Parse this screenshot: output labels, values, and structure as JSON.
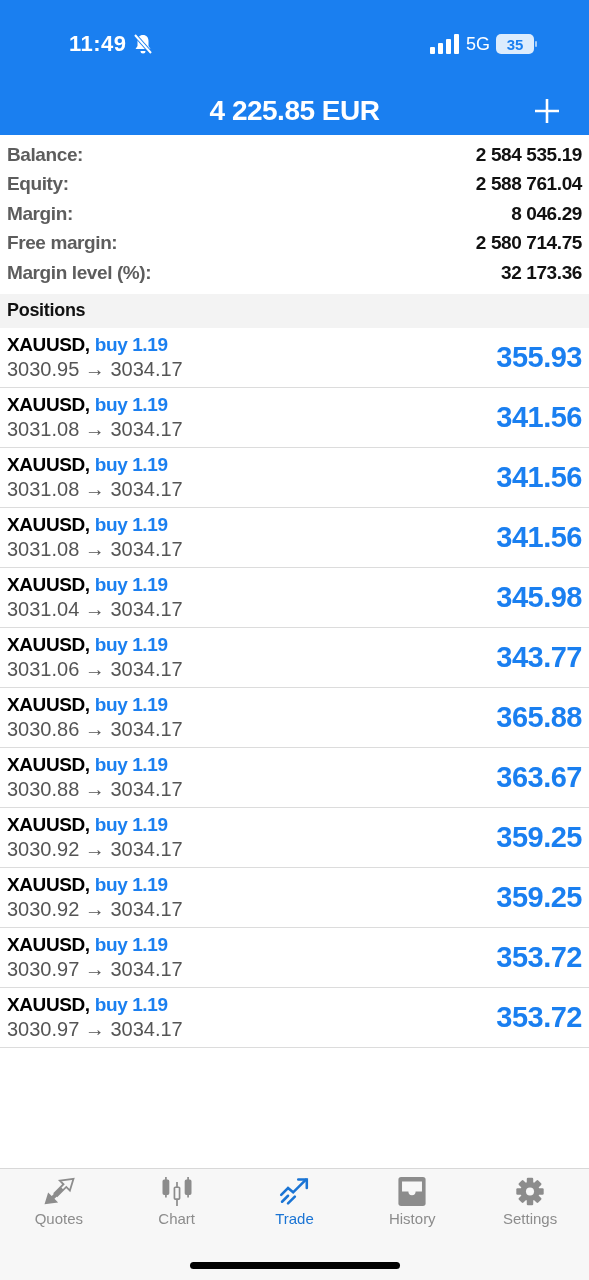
{
  "status_bar": {
    "time": "11:49",
    "network": "5G",
    "battery": "35"
  },
  "header": {
    "title": "4 225.85 EUR"
  },
  "summary": [
    {
      "label": "Balance:",
      "value": "2 584 535.19"
    },
    {
      "label": "Equity:",
      "value": "2 588 761.04"
    },
    {
      "label": "Margin:",
      "value": "8 046.29"
    },
    {
      "label": "Free margin:",
      "value": "2 580 714.75"
    },
    {
      "label": "Margin level (%):",
      "value": "32 173.36"
    }
  ],
  "positions": {
    "title": "Positions",
    "rows": [
      {
        "symbol": "XAUUSD,",
        "order": "buy 1.19",
        "prices": "3030.95 → 3034.17",
        "profit": "355.93"
      },
      {
        "symbol": "XAUUSD,",
        "order": "buy 1.19",
        "prices": "3031.08 → 3034.17",
        "profit": "341.56"
      },
      {
        "symbol": "XAUUSD,",
        "order": "buy 1.19",
        "prices": "3031.08 → 3034.17",
        "profit": "341.56"
      },
      {
        "symbol": "XAUUSD,",
        "order": "buy 1.19",
        "prices": "3031.08 → 3034.17",
        "profit": "341.56"
      },
      {
        "symbol": "XAUUSD,",
        "order": "buy 1.19",
        "prices": "3031.04 → 3034.17",
        "profit": "345.98"
      },
      {
        "symbol": "XAUUSD,",
        "order": "buy 1.19",
        "prices": "3031.06 → 3034.17",
        "profit": "343.77"
      },
      {
        "symbol": "XAUUSD,",
        "order": "buy 1.19",
        "prices": "3030.86 → 3034.17",
        "profit": "365.88"
      },
      {
        "symbol": "XAUUSD,",
        "order": "buy 1.19",
        "prices": "3030.88 → 3034.17",
        "profit": "363.67"
      },
      {
        "symbol": "XAUUSD,",
        "order": "buy 1.19",
        "prices": "3030.92 → 3034.17",
        "profit": "359.25"
      },
      {
        "symbol": "XAUUSD,",
        "order": "buy 1.19",
        "prices": "3030.92 → 3034.17",
        "profit": "359.25"
      },
      {
        "symbol": "XAUUSD,",
        "order": "buy 1.19",
        "prices": "3030.97 → 3034.17",
        "profit": "353.72"
      },
      {
        "symbol": "XAUUSD,",
        "order": "buy 1.19",
        "prices": "3030.97 → 3034.17",
        "profit": "353.72"
      }
    ]
  },
  "tabs": [
    {
      "label": "Quotes",
      "selected": false
    },
    {
      "label": "Chart",
      "selected": false
    },
    {
      "label": "Trade",
      "selected": true
    },
    {
      "label": "History",
      "selected": false
    },
    {
      "label": "Settings",
      "selected": false
    }
  ]
}
